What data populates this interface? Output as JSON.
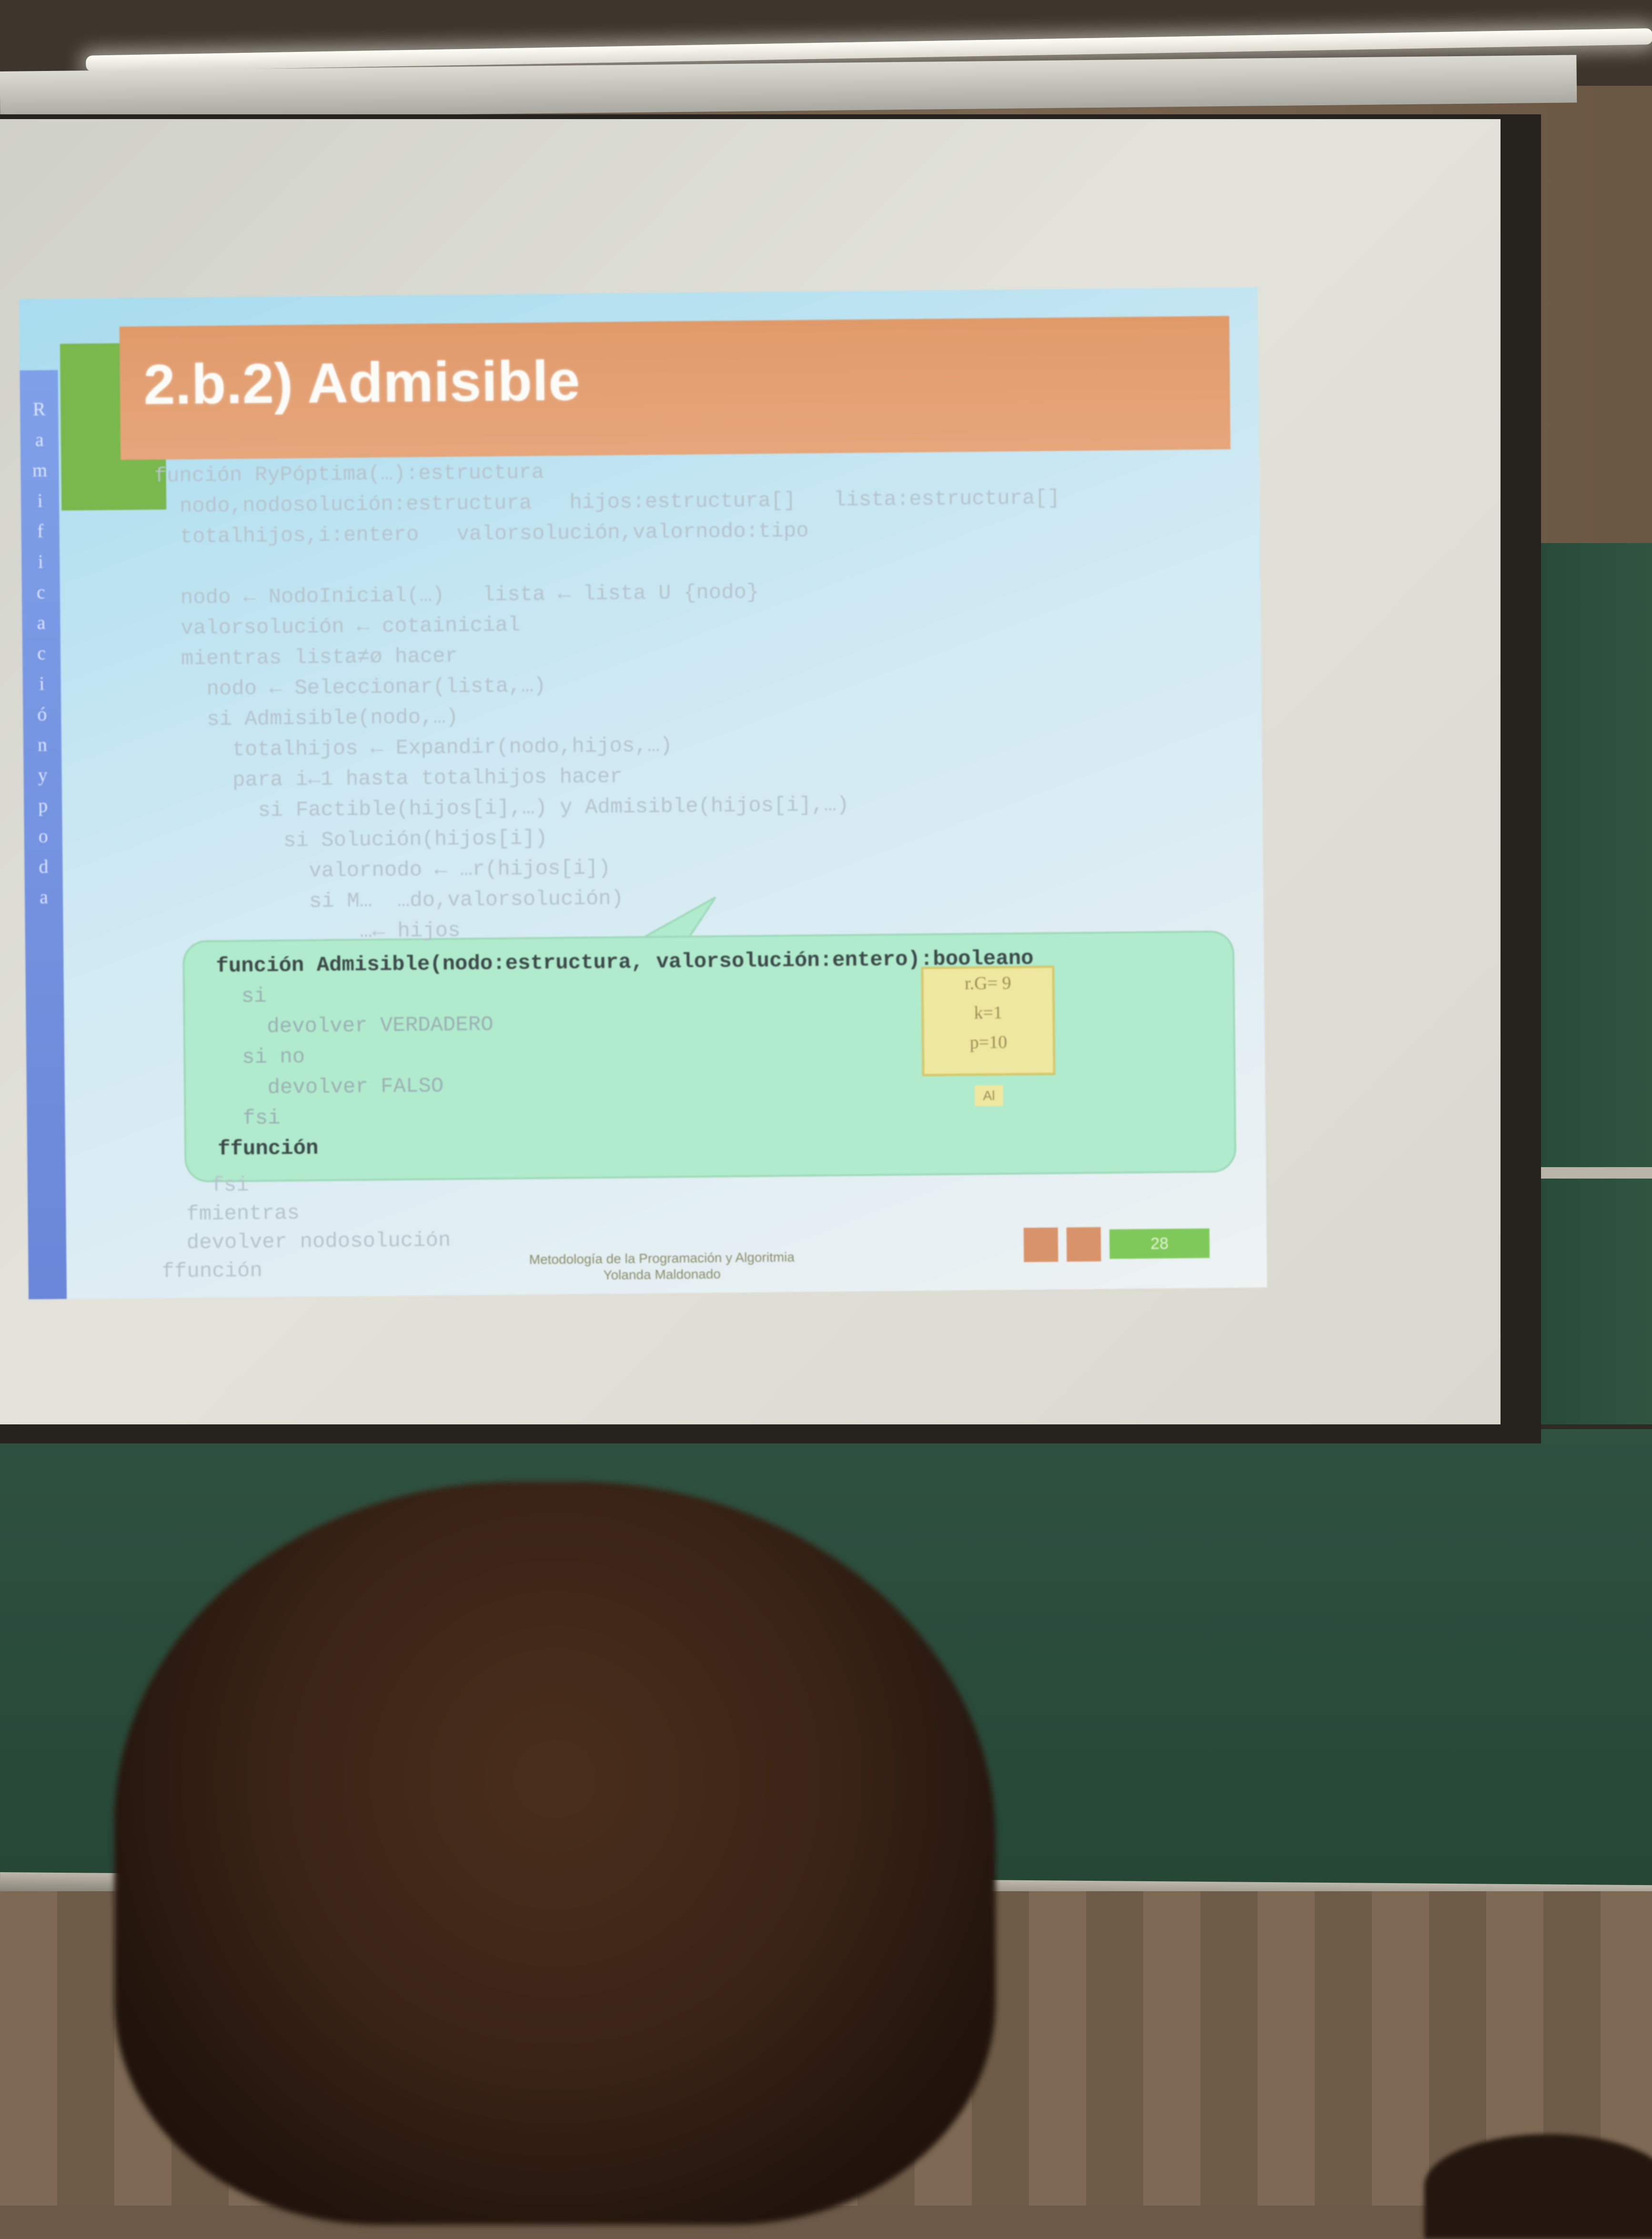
{
  "slide": {
    "title": "2.b.2) Admisible",
    "sidebar_letters": [
      "R",
      "a",
      "m",
      "i",
      "f",
      "i",
      "c",
      "a",
      "c",
      "i",
      "ó",
      "n",
      "y",
      "p",
      "o",
      "d",
      "a"
    ],
    "code_lines": [
      "función RyPóptima(…):estructura",
      "  nodo,nodosolución:estructura   hijos:estructura[]   lista:estructura[]",
      "  totalhijos,i:entero   valorsolución,valornodo:tipo",
      "",
      "  nodo ← NodoInicial(…)   lista ← lista U {nodo}",
      "  valorsolución ← cotainicial",
      "  mientras lista≠ø hacer",
      "    nodo ← Seleccionar(lista,…)",
      "    si Admisible(nodo,…)",
      "      totalhijos ← Expandir(nodo,hijos,…)",
      "      para i←1 hasta totalhijos hacer",
      "        si Factible(hijos[i],…) y Admisible(hijos[i],…)",
      "          si Solución(hijos[i])",
      "            valornodo ← …r(hijos[i])",
      "            si M…  …do,valorsolución)",
      "                …← hijos"
    ],
    "callout_lines": [
      "función Admisible(nodo:estructura, valorsolución:entero):booleano",
      "  si",
      "    devolver VERDADERO",
      "  si no",
      "    devolver FALSO",
      "  fsi",
      "ffunción"
    ],
    "after_lines": [
      "    fsi",
      "  fmientras",
      "  devolver nodosolución",
      "ffunción"
    ],
    "tree_box": [
      "r.G= 9",
      "k=1",
      "p=10"
    ],
    "tree_node": "Al",
    "footer": [
      "Metodología de la Programación y Algoritmia",
      "Yolanda Maldonado"
    ],
    "page": "28"
  },
  "colors": {
    "title_bar": "#e09a6a",
    "green_corner": "#78b84c",
    "sidebar": "#7fa0e8",
    "callout": "#b0ebcd",
    "chalkboard": "#2f5140"
  }
}
